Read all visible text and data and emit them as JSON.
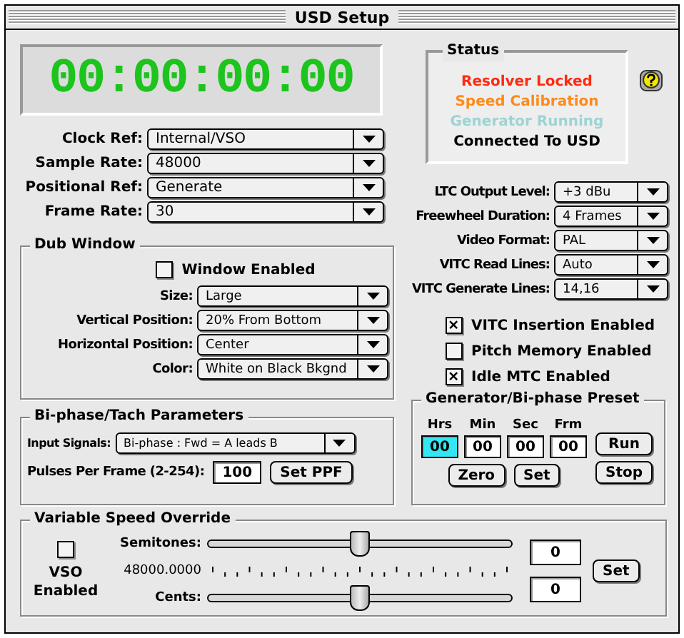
{
  "window": {
    "title": "USD Setup"
  },
  "timecode": "00:00:00:00",
  "clock_settings": [
    {
      "label": "Clock Ref:",
      "value": "Internal/VSO"
    },
    {
      "label": "Sample Rate:",
      "value": "48000"
    },
    {
      "label": "Positional Ref:",
      "value": "Generate"
    },
    {
      "label": "Frame Rate:",
      "value": "30"
    }
  ],
  "dub_window": {
    "title": "Dub Window",
    "enabled": {
      "label": "Window Enabled",
      "checked": false
    },
    "settings": [
      {
        "label": "Size:",
        "value": "Large"
      },
      {
        "label": "Vertical Position:",
        "value": "20% From Bottom"
      },
      {
        "label": "Horizontal Position:",
        "value": "Center"
      },
      {
        "label": "Color:",
        "value": "White on Black Bkgnd"
      }
    ]
  },
  "biphase": {
    "title": "Bi-phase/Tach Parameters",
    "input_signals": {
      "label": "Input Signals:",
      "value": "Bi-phase : Fwd = A leads B"
    },
    "pulses": {
      "label": "Pulses Per Frame (2-254):",
      "value": "100"
    },
    "set_button": "Set PPF"
  },
  "status": {
    "title": "Status",
    "lines": [
      {
        "text": "Resolver Locked",
        "color": "#ff2a10"
      },
      {
        "text": "Speed Calibration",
        "color": "#ff8a1a"
      },
      {
        "text": "Generator Running",
        "color": "#9fd3d3"
      },
      {
        "text": "Connected To USD",
        "color": "#000000"
      }
    ]
  },
  "output_settings": [
    {
      "label": "LTC Output Level:",
      "value": "+3 dBu"
    },
    {
      "label": "Freewheel Duration:",
      "value": "4 Frames"
    },
    {
      "label": "Video Format:",
      "value": "PAL"
    },
    {
      "label": "VITC Read Lines:",
      "value": "Auto"
    },
    {
      "label": "VITC Generate Lines:",
      "value": "14,16"
    }
  ],
  "options": [
    {
      "label": "VITC Insertion Enabled",
      "checked": true
    },
    {
      "label": "Pitch Memory Enabled",
      "checked": false
    },
    {
      "label": "Idle MTC Enabled",
      "checked": true
    }
  ],
  "preset": {
    "title": "Generator/Bi-phase Preset",
    "fields": [
      {
        "label": "Hrs",
        "value": "00",
        "selected": true
      },
      {
        "label": "Min",
        "value": "00",
        "selected": false
      },
      {
        "label": "Sec",
        "value": "00",
        "selected": false
      },
      {
        "label": "Frm",
        "value": "00",
        "selected": false
      }
    ],
    "buttons": [
      "Zero",
      "Set",
      "Run",
      "Stop"
    ]
  },
  "vso": {
    "title": "Variable Speed Override",
    "enabled": {
      "label": "VSO Enabled",
      "checked": false
    },
    "rate": "48000.0000",
    "sliders": [
      {
        "label": "Semitones:",
        "level": 0.5,
        "value": "0"
      },
      {
        "label": "Cents:",
        "level": 0.5,
        "value": "0"
      }
    ],
    "set_button": "Set"
  }
}
